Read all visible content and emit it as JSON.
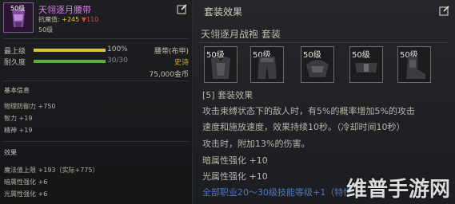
{
  "item": {
    "level_badge": "50级",
    "title": "天翎逐月腰带",
    "subline_label": "抗魔值:",
    "subline_up": "+245",
    "subline_down": "▼110",
    "level": "50级",
    "stats": [
      {
        "label": "最上级",
        "value": "100%",
        "fraction": 1.0,
        "color": "#d8c542"
      },
      {
        "label": "耐久度",
        "value": "30/30",
        "fraction": 1.0,
        "color": "#58b13c"
      }
    ],
    "slot_type": "腰带(布甲)",
    "rarity": "史诗",
    "price": "75,000金币",
    "basic_info_header": "基本信息",
    "basic_info": [
      "物理防御力 +750",
      "智力 +19",
      "精神 +19"
    ],
    "effects_header": "效果",
    "effects": [
      "魔法值上限 +193（实际+775）",
      "暗属性强化 +6",
      "光属性强化 +6"
    ]
  },
  "set": {
    "title": "套装效果",
    "name": "天翎逐月战袍  套装",
    "slots": [
      "50级",
      "50级",
      "50级",
      "50级",
      "50级"
    ],
    "lines": [
      "[5] 套装效果",
      "攻击束缚状态下的敌人时，有5%的概率增加5%的攻击",
      "速度和施放速度，效果持续10秒。（冷却时间10秒）",
      "攻击时，附加13%的伤害。",
      "暗属性强化 +10",
      "光属性强化 +10",
      "全部职业20～30级技能等级+1（特性"
    ]
  },
  "watermark": "维普手游网",
  "colors": {
    "item_name": "#d77ce8",
    "stat_up": "#e5c53a",
    "stat_down": "#e04141",
    "epic": "#d3a640",
    "skill_line": "#4f78bd"
  }
}
